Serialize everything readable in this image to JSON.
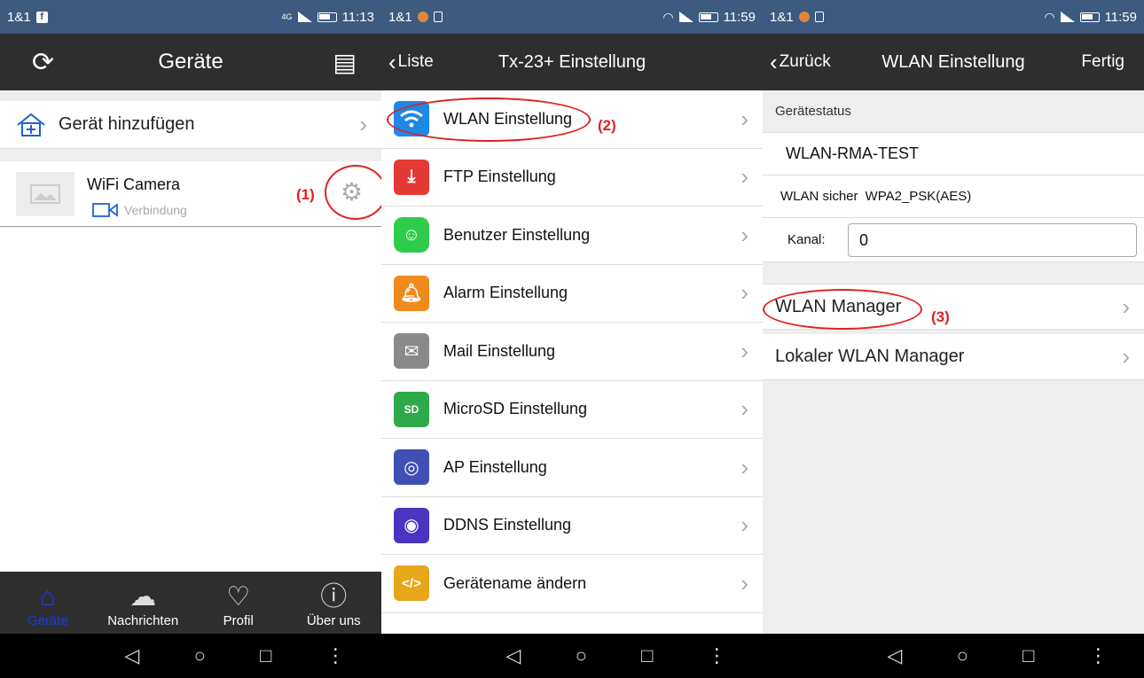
{
  "panel1": {
    "status": {
      "carrier": "1&1",
      "net": "4G",
      "time": "11:13"
    },
    "nav": {
      "title": "Geräte"
    },
    "add_device": {
      "label": "Gerät hinzufügen"
    },
    "device": {
      "name": "WiFi Camera",
      "status": "Verbindung"
    },
    "annotation": "(1)",
    "tabs": [
      {
        "label": "Geräte",
        "icon": "home-icon"
      },
      {
        "label": "Nachrichten",
        "icon": "cloud-icon"
      },
      {
        "label": "Profil",
        "icon": "heart-icon"
      },
      {
        "label": "Über uns",
        "icon": "info-icon"
      }
    ]
  },
  "panel2": {
    "status": {
      "carrier": "1&1",
      "time": "11:59"
    },
    "nav": {
      "back": "Liste",
      "title": "Tx-23+ Einstellung"
    },
    "annotation": "(2)",
    "items": [
      {
        "label": "WLAN Einstellung",
        "icon": "wifi-icon",
        "color": "#1e88e5"
      },
      {
        "label": "FTP Einstellung",
        "icon": "download-icon",
        "color": "#e53935"
      },
      {
        "label": "Benutzer Einstellung",
        "icon": "user-icon",
        "color": "#2ecc4a"
      },
      {
        "label": "Alarm Einstellung",
        "icon": "bell-icon",
        "color": "#f08a1c"
      },
      {
        "label": "Mail Einstellung",
        "icon": "mail-icon",
        "color": "#8a8a8a"
      },
      {
        "label": "MicroSD Einstellung",
        "icon": "sd-icon",
        "color": "#2eaa4a"
      },
      {
        "label": "AP Einstellung",
        "icon": "ap-icon",
        "color": "#3f51b5"
      },
      {
        "label": "DDNS Einstellung",
        "icon": "ddns-icon",
        "color": "#4a35c0"
      },
      {
        "label": "Gerätename ändern",
        "icon": "code-icon",
        "color": "#e6a81a"
      }
    ]
  },
  "panel3": {
    "status": {
      "carrier": "1&1",
      "time": "11:59"
    },
    "nav": {
      "back": "Zurück",
      "title": "WLAN Einstellung",
      "done": "Fertig"
    },
    "section": "Gerätestatus",
    "ssid": "WLAN-RMA-TEST",
    "security_label": "WLAN sicher",
    "security_value": "WPA2_PSK(AES)",
    "channel_label": "Kanal:",
    "channel_value": "0",
    "annotation": "(3)",
    "managers": [
      {
        "label": "WLAN Manager"
      },
      {
        "label": "Lokaler WLAN Manager"
      }
    ]
  },
  "android_nav": {
    "back": "◁",
    "home": "○",
    "recents": "□",
    "menu": "⋮"
  }
}
